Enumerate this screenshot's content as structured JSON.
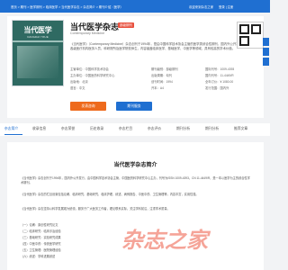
{
  "topbar": {
    "crumbs": "首页 > 期刊 > 医学期刊 > 临床医学 > 当代医学杂志 > 杂志简介 > 期刊介绍（医学）",
    "welcome": "欢迎来到杂志之家",
    "login": "登录 | 注册"
  },
  "journal": {
    "cover_title": "当代医学",
    "cover_en": "DANGDAI YIXUE",
    "title": "当代医学杂志",
    "badge": "部级期刊",
    "subtitle": "Contemporary Medicine",
    "description": "《当代医学》（Contemporary Medicine）杂志创刊于1994年，是由中国科学技术协会主管的医学类综合性期刊，国内外公开发行，面向全国各级医疗机构医务人员、科研院所及医学院校师生，内容涵盖临床医学、基础医学、中医学等领域，具有较高的学术价值。",
    "meta": {
      "row1": [
        "主管单位：中国科学技术协会",
        "期刊级别：部级期刊",
        "国际刊号：1009-4393"
      ],
      "row2": [
        "主办单位：中国医药科学研究中心",
        "出版周期：旬刊",
        "国内刊号：11-4449/R"
      ],
      "row3": [
        "出版地：北京",
        "创刊时间：1994",
        "全年订价：¥ 1080.00"
      ],
      "row4": [
        "语言：中文",
        "开本：A4",
        "发行范围：国内外"
      ]
    },
    "submit_label": "发表咨询",
    "service_label": "期刊服务"
  },
  "tabs": [
    "杂志简介",
    "收录信息",
    "杂志荣誉",
    "历史收录",
    "杂志栏目",
    "杂志评价",
    "期刊分析",
    "期刊分析",
    "推荐文章"
  ],
  "content": {
    "heading": "当代医学杂志简介",
    "paragraphs": [
      "《当代医学》杂志创刊于1994年，国内外公开发行，由中国科学技术协会主管，中国医药科学研究中心主办，刊号为ISSN 1009-4393，CN 11-4449/R，是一本以医学为主的综合性学术期刊。",
      "《当代医学》杂志的栏目设置包括论著、临床研究、基础研究、临床护理、综述、病例报告、中医中药、卫生管理等，内容丰富，实用性强。",
      "《当代医学》杂志坚持以科学发展观为统领，服务于广大医务工作者，理论联系实际，关注学科前沿，注重学术质量。"
    ],
    "list": [
      "（一）论著：原创性研究论文",
      "（二）临床研究：临床诊治经验",
      "（三）基础研究：实验研究成果",
      "（四）中医中药：传统医学研究",
      "（五）卫生管理：医院管理经验",
      "（六）综述：学科进展综述"
    ]
  },
  "watermark": "杂志之家"
}
